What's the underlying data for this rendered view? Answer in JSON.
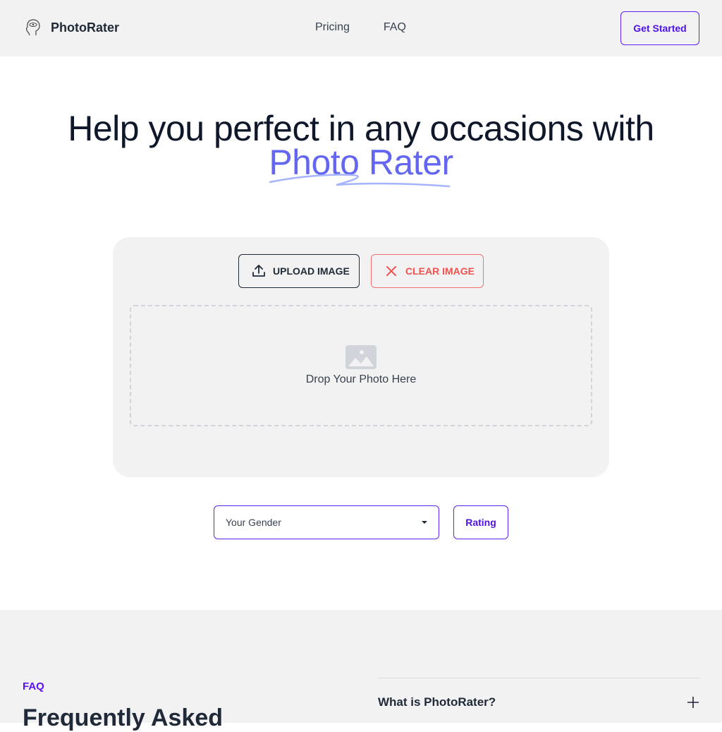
{
  "header": {
    "brand": "PhotoRater",
    "nav": [
      "Pricing",
      "FAQ"
    ],
    "cta_label": "Get Started"
  },
  "hero": {
    "title_line1": "Help you perfect in any occasions with",
    "title_accent": "Photo Rater"
  },
  "uploader": {
    "upload_label": "UPLOAD IMAGE",
    "clear_label": "CLEAR IMAGE",
    "dropzone_text": "Drop Your Photo Here"
  },
  "controls": {
    "gender_selected": "Your Gender",
    "rating_label": "Rating"
  },
  "faq": {
    "eyebrow": "FAQ",
    "title": "Frequently Asked",
    "items": [
      {
        "question": "What is PhotoRater?"
      }
    ]
  },
  "colors": {
    "accent": "#6366f1",
    "brand_purple": "#5b21f5",
    "danger": "#ef5350"
  }
}
